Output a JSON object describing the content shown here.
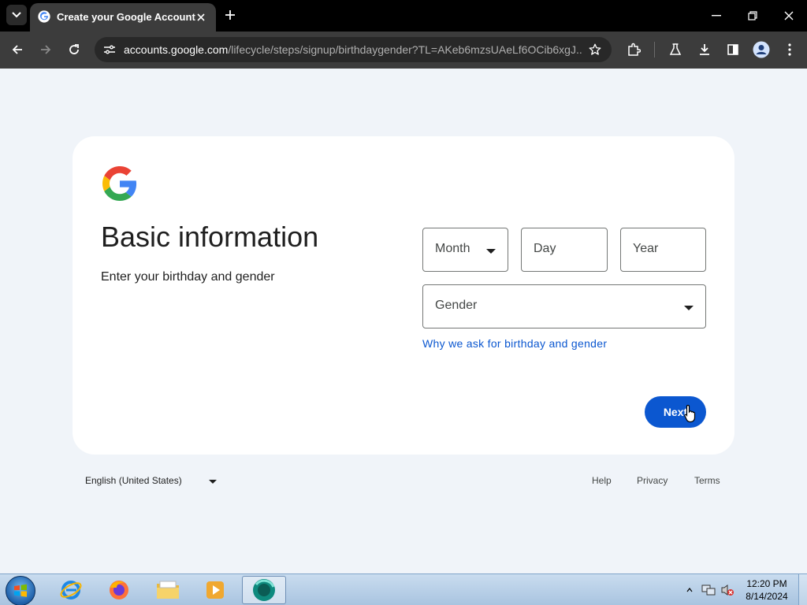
{
  "browser": {
    "tab_title": "Create your Google Account",
    "url_host": "accounts.google.com",
    "url_path": "/lifecycle/steps/signup/birthdaygender?TL=AKeb6mzsUAeLf6OCib6xgJ..."
  },
  "page": {
    "heading": "Basic information",
    "subheading": "Enter your birthday and gender",
    "month_placeholder": "Month",
    "day_placeholder": "Day",
    "year_placeholder": "Year",
    "gender_placeholder": "Gender",
    "why_link": "Why we ask for birthday and gender",
    "next_label": "Next"
  },
  "footer": {
    "language": "English (United States)",
    "help": "Help",
    "privacy": "Privacy",
    "terms": "Terms"
  },
  "taskbar": {
    "time": "12:20 PM",
    "date": "8/14/2024"
  },
  "colors": {
    "primary_blue": "#0b57d0",
    "page_background": "#f0f4f9",
    "card_background": "#ffffff"
  },
  "icons": [
    "tab-list-icon",
    "google-favicon",
    "close-icon",
    "plus-icon",
    "minimize-icon",
    "restore-icon",
    "back-icon",
    "forward-icon",
    "reload-icon",
    "site-info-icon",
    "star-icon",
    "extensions-icon",
    "labs-icon",
    "download-icon",
    "side-panel-icon",
    "profile-icon",
    "more-icon",
    "google-logo",
    "chevron-down-icon",
    "hand-cursor-icon",
    "windows-start-icon",
    "internet-explorer-icon",
    "firefox-icon",
    "file-explorer-icon",
    "media-player-icon",
    "chrome-app-icon",
    "network-icon",
    "volume-muted-icon"
  ]
}
